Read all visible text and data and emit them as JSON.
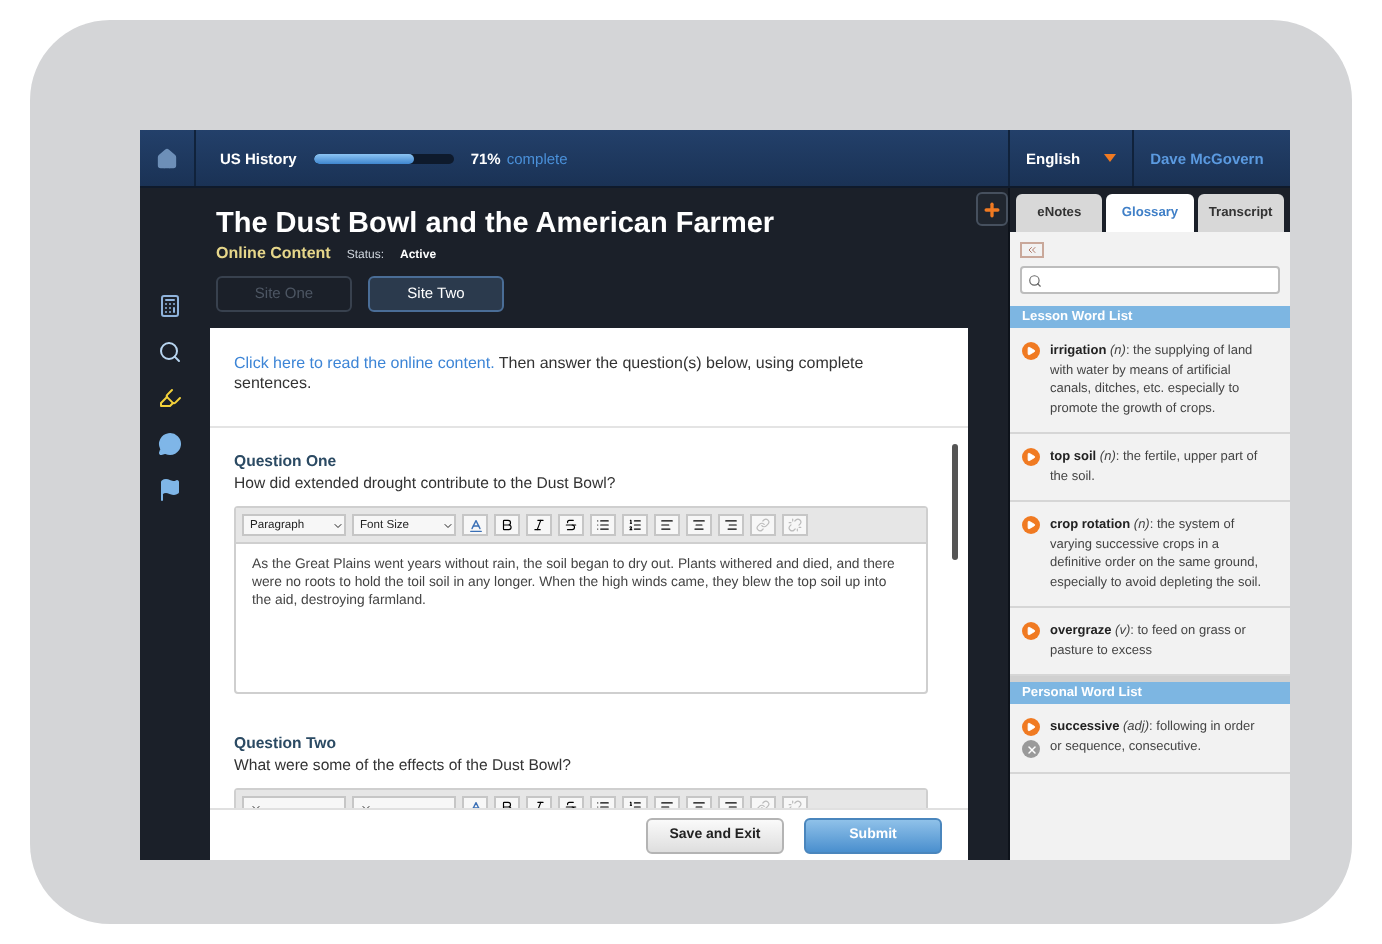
{
  "top_bar": {
    "course": "US History",
    "progress": {
      "level": 0.71,
      "percent": "71%",
      "label": "complete"
    },
    "language": "English",
    "user": "Dave McGovern"
  },
  "lesson": {
    "title": "The Dust Bowl and the American Farmer",
    "type": "Online Content",
    "status_label": "Status:",
    "status": "Active"
  },
  "site_tabs": [
    {
      "label": "Site One",
      "selected": false
    },
    {
      "label": "Site Two",
      "selected": true
    }
  ],
  "intro": {
    "link": "Click here to read the online content.",
    "text": "Then answer the question(s) below, using complete sentences."
  },
  "editor_toolbar": {
    "format": "Paragraph",
    "font_size": "Font Size"
  },
  "questions": [
    {
      "title": "Question One",
      "prompt": "How did extended drought contribute to the Dust Bowl?",
      "answer": "As the Great Plains went years without rain, the soil began to dry out. Plants withered and died, and there were no roots to hold the toil soil in any longer. When the high winds came, they blew the top soil up into the aid, destroying farmland."
    },
    {
      "title": "Question Two",
      "prompt": "What were some of the effects of the Dust Bowl?"
    }
  ],
  "footer_buttons": [
    {
      "label": "Save and Exit",
      "kind": "secondary"
    },
    {
      "label": "Submit",
      "kind": "primary"
    }
  ],
  "panel_tabs": [
    {
      "label": "eNotes",
      "selected": false
    },
    {
      "label": "Glossary",
      "selected": true
    },
    {
      "label": "Transcript",
      "selected": false
    }
  ],
  "word_lists": [
    {
      "title": "Lesson Word List",
      "entries": [
        {
          "term": "**irrigation** *(n)*: the supplying of land with water by means of artificial canals, ditches, etc. especially to promote the growth of crops.",
          "removable": false
        },
        {
          "term": "**top soil** *(n)*: the fertile, upper part of the soil.",
          "removable": false
        },
        {
          "term": "**crop rotation** *(n)*: the system of varying successive crops in a definitive order on the same ground, especially to avoid depleting the soil.",
          "removable": false
        },
        {
          "term": "**overgraze** *(v)*: to feed on grass or pasture to excess",
          "removable": false
        }
      ]
    },
    {
      "title": "Personal Word List",
      "entries": [
        {
          "term": "**successive** *(adj)*: following in order or sequence, consecutive.",
          "removable": true
        }
      ]
    }
  ]
}
